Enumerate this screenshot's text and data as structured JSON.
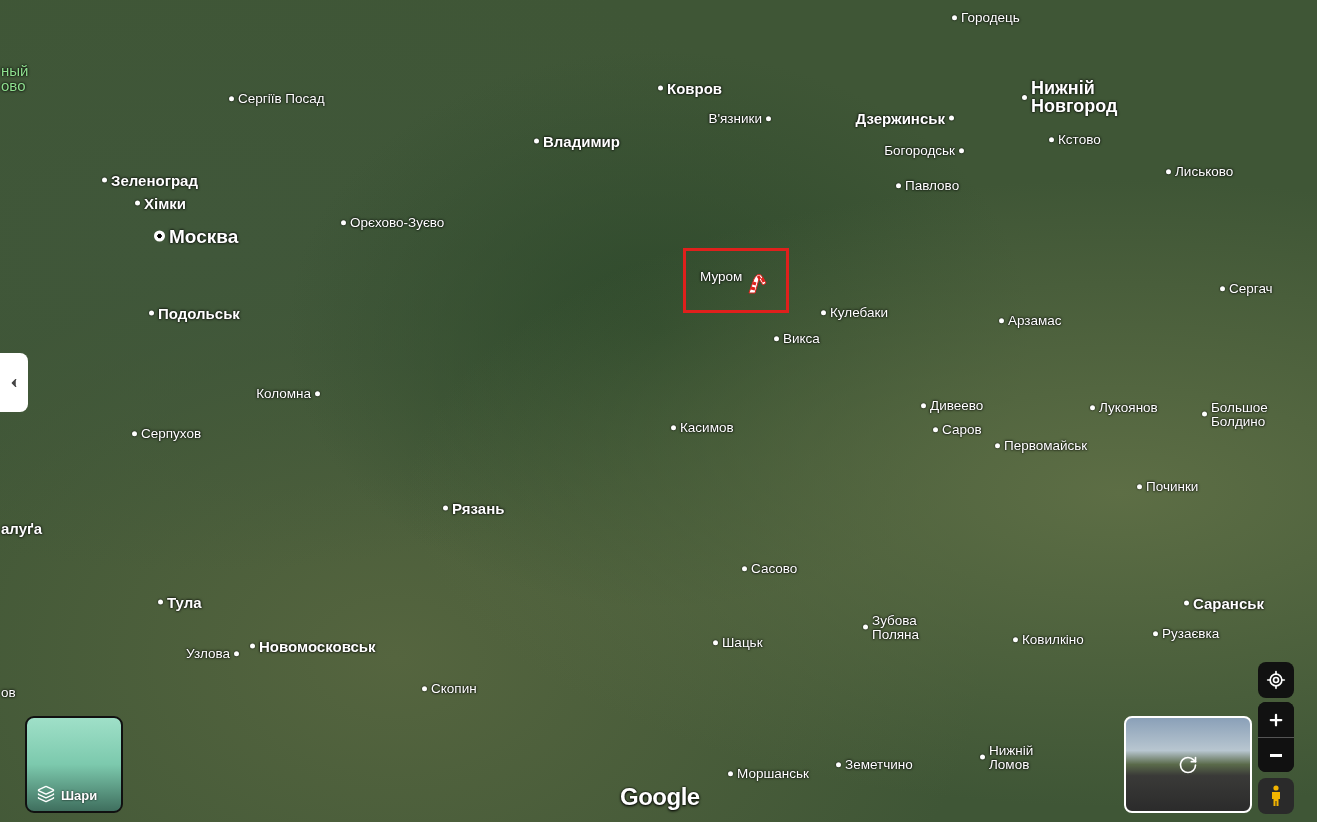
{
  "map": {
    "labels": [
      {
        "text": "Городець",
        "kind": "minor"
      },
      {
        "text": "ный\nово",
        "kind": "park"
      },
      {
        "text": "Сергіїв Посад",
        "kind": "minor"
      },
      {
        "text": "Ковров",
        "kind": "bold"
      },
      {
        "text": "Нижній\nНовгород",
        "kind": "major"
      },
      {
        "text": "Владимир",
        "kind": "bold"
      },
      {
        "text": "В'язники",
        "kind": "minor"
      },
      {
        "text": "Дзержинськ",
        "kind": "bold"
      },
      {
        "text": "Богородськ",
        "kind": "minor"
      },
      {
        "text": "Кстово",
        "kind": "minor"
      },
      {
        "text": "Зеленоград",
        "kind": "bold"
      },
      {
        "text": "Павлово",
        "kind": "minor"
      },
      {
        "text": "Лиськово",
        "kind": "minor"
      },
      {
        "text": "Хімки",
        "kind": "bold"
      },
      {
        "text": "Москва",
        "kind": "capital"
      },
      {
        "text": "Орєхово-Зуєво",
        "kind": "minor"
      },
      {
        "text": "Муром",
        "kind": "plain"
      },
      {
        "text": "Сергач",
        "kind": "minor"
      },
      {
        "text": "Подольськ",
        "kind": "bold"
      },
      {
        "text": "Кулебаки",
        "kind": "minor"
      },
      {
        "text": "Арзамас",
        "kind": "minor"
      },
      {
        "text": "Викса",
        "kind": "minor"
      },
      {
        "text": "Коломна",
        "kind": "minor"
      },
      {
        "text": "Серпухов",
        "kind": "minor"
      },
      {
        "text": "Касимов",
        "kind": "minor"
      },
      {
        "text": "Дивеево",
        "kind": "minor"
      },
      {
        "text": "Саров",
        "kind": "minor"
      },
      {
        "text": "Лукоянов",
        "kind": "minor"
      },
      {
        "text": "Большое\nБолдино",
        "kind": "minor"
      },
      {
        "text": "Первомайськ",
        "kind": "minor"
      },
      {
        "text": "Починки",
        "kind": "minor"
      },
      {
        "text": "Рязань",
        "kind": "bold"
      },
      {
        "text": "алуґа",
        "kind": "edge-bold"
      },
      {
        "text": "Сасово",
        "kind": "minor"
      },
      {
        "text": "Тула",
        "kind": "bold"
      },
      {
        "text": "Саранськ",
        "kind": "bold"
      },
      {
        "text": "Узлова",
        "kind": "minor"
      },
      {
        "text": "Новомосковськ",
        "kind": "bold"
      },
      {
        "text": "Шацьк",
        "kind": "minor"
      },
      {
        "text": "Зубова\nПоляна",
        "kind": "minor"
      },
      {
        "text": "Ковилкіно",
        "kind": "minor"
      },
      {
        "text": "Рузаєвка",
        "kind": "minor"
      },
      {
        "text": "ов",
        "kind": "edge"
      },
      {
        "text": "Скопин",
        "kind": "minor"
      },
      {
        "text": "Моршанськ",
        "kind": "minor"
      },
      {
        "text": "Земетчино",
        "kind": "minor"
      },
      {
        "text": "Нижній\nЛомов",
        "kind": "minor"
      }
    ]
  },
  "layers_button": {
    "label": "Шари"
  },
  "logo": "Google"
}
